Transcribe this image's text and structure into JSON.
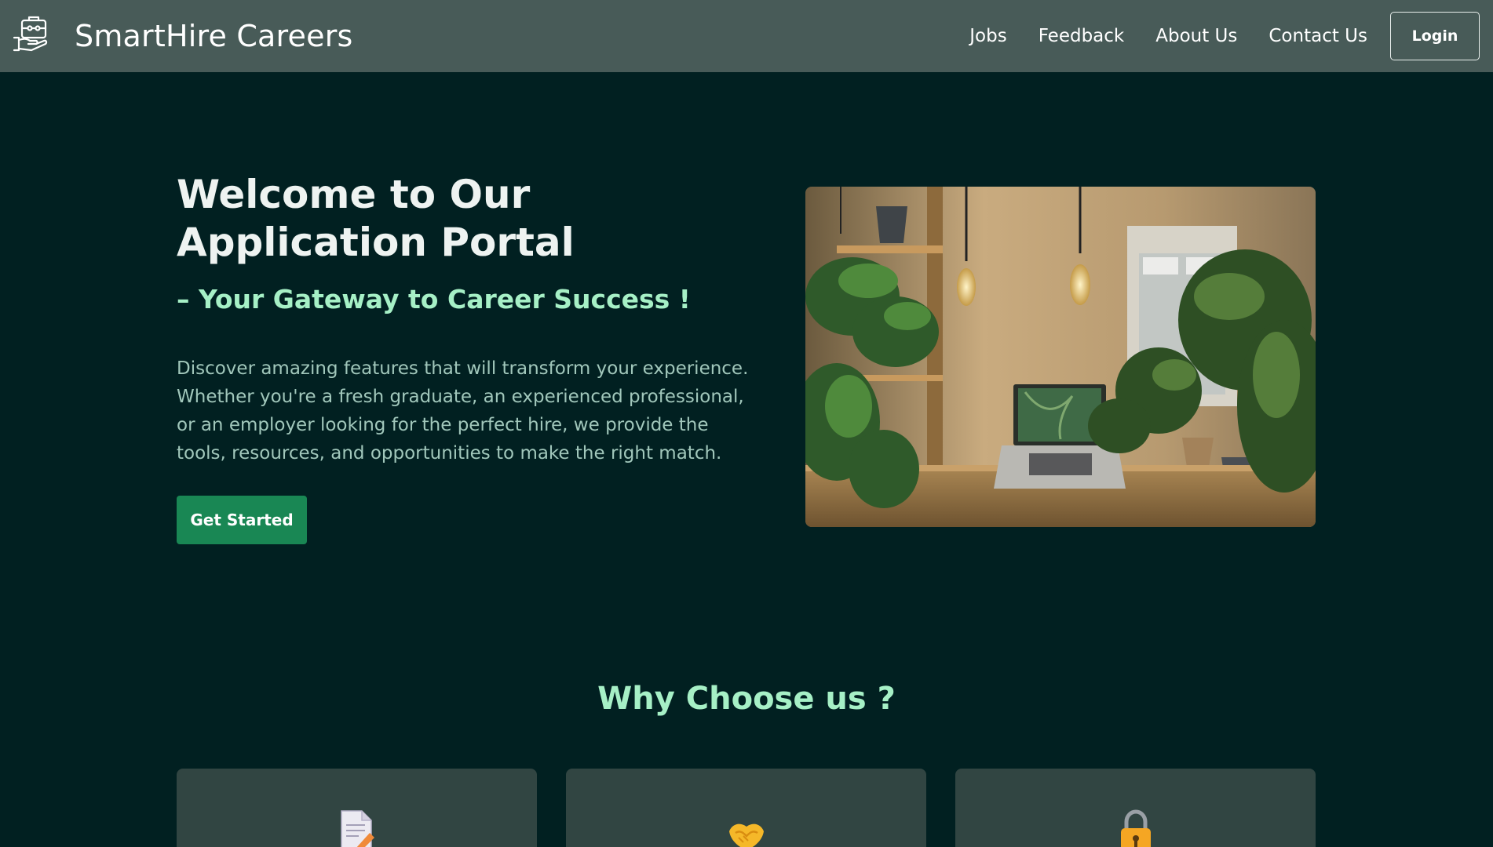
{
  "header": {
    "brand_name": "SmartHire Careers",
    "brand_icon": "briefcase-hand-icon",
    "nav_items": [
      "Jobs",
      "Feedback",
      "About Us",
      "Contact Us"
    ],
    "login_label": "Login"
  },
  "hero": {
    "title": "Welcome to Our Application Portal",
    "subtitle": "– Your Gateway to Career Success !",
    "description": "Discover amazing features that will transform your experience. Whether you're a fresh graduate, an experienced professional, or an employer looking for the perfect hire, we provide the tools, resources, and opportunities to make the right match.",
    "cta_label": "Get Started",
    "image": "workspace-plants-laptop-photo"
  },
  "why_choose": {
    "title": "Why Choose us ?",
    "cards": [
      {
        "icon": "document-pencil-icon"
      },
      {
        "icon": "handshake-icon"
      },
      {
        "icon": "lock-icon"
      }
    ]
  },
  "colors": {
    "background": "#012021",
    "navbar": "#485b58",
    "accent_green": "#a6f0c6",
    "button_green": "#198754",
    "card_bg": "#314542"
  }
}
